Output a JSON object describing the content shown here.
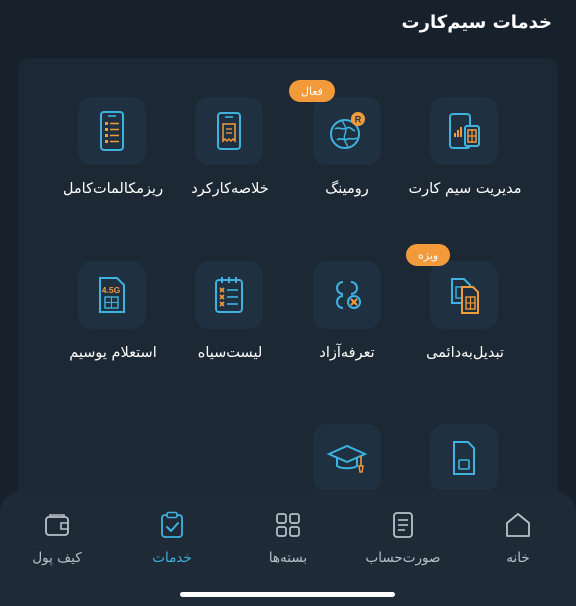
{
  "header": {
    "title": "خدمات سیم‌کارت"
  },
  "services": [
    {
      "id": "sim-management",
      "label": "مدیریت سیم کارت",
      "icon": "sim-management-icon"
    },
    {
      "id": "roaming",
      "label": "رومینگ",
      "icon": "globe-roaming-icon",
      "badge": "فعال"
    },
    {
      "id": "usage-summary",
      "label": "خلاصه‌کارکرد",
      "icon": "receipt-phone-icon"
    },
    {
      "id": "call-details",
      "label": "ریزمکالمات‌کامل",
      "icon": "call-list-phone-icon"
    },
    {
      "id": "convert-permanent",
      "label": "تبدیل‌به‌دائمی",
      "icon": "sim-stack-icon",
      "badge": "ویژه"
    },
    {
      "id": "free-tariff",
      "label": "تعرفه‌آزاد",
      "icon": "tariff-shapes-icon"
    },
    {
      "id": "blacklist",
      "label": "لیست‌سیاه",
      "icon": "checklist-icon"
    },
    {
      "id": "usim-inquiry",
      "label": "استعلام یوسیم",
      "icon": "usim-4-5g-icon",
      "sim_text": "4.5G"
    },
    {
      "id": "sim-card",
      "label": "",
      "icon": "sim-card-icon"
    },
    {
      "id": "student",
      "label": "",
      "icon": "graduation-cap-icon"
    }
  ],
  "bottom_nav": [
    {
      "id": "home",
      "label": "خانه",
      "icon": "home-icon",
      "active": false
    },
    {
      "id": "bill",
      "label": "صورت‌حساب",
      "icon": "bill-icon",
      "active": false
    },
    {
      "id": "packages",
      "label": "بسته‌ها",
      "icon": "grid-icon",
      "active": false
    },
    {
      "id": "services",
      "label": "خدمات",
      "icon": "clipboard-check-icon",
      "active": true
    },
    {
      "id": "wallet",
      "label": "کیف پول",
      "icon": "wallet-icon",
      "active": false
    }
  ],
  "colors": {
    "background": "#17212c",
    "panel": "#1c2834",
    "tile": "#1f3140",
    "accent_blue": "#3fb2e0",
    "accent_orange": "#f39a3b"
  }
}
